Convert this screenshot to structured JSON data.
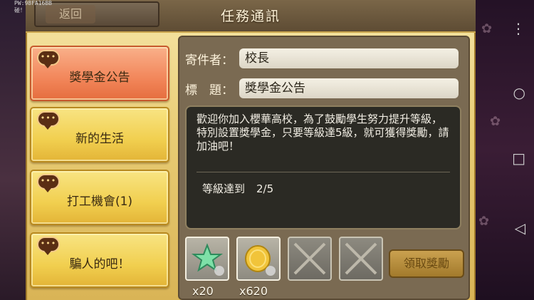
{
  "debug": {
    "line1": "PW:98FA16BB",
    "line2": "碰！"
  },
  "header": {
    "title": "任務通訊",
    "back_label": "返回"
  },
  "tabs": [
    {
      "label": "獎學金公告",
      "active": true
    },
    {
      "label": "新的生活",
      "active": false
    },
    {
      "label": "打工機會(1)",
      "active": false
    },
    {
      "label": "騙人的吧！",
      "active": false
    }
  ],
  "bubble_text": "•••",
  "mail": {
    "sender_label": "寄件者：",
    "sender": "校長",
    "subject_label": "標　題：",
    "subject": "獎學金公告",
    "body": "歡迎你加入櫻華高校，為了鼓勵學生努力提升等級，特別設置獎學金，只要等級達5級，就可獲得獎勵，請加油吧！",
    "requirement_label": "等級達到",
    "requirement_value": "2/5"
  },
  "rewards": [
    {
      "icon": "star-icon",
      "qty": "x20"
    },
    {
      "icon": "gold-coin-icon",
      "qty": "x620"
    },
    {
      "icon": "empty-slot-icon",
      "qty": ""
    },
    {
      "icon": "empty-slot-icon",
      "qty": ""
    }
  ],
  "claim_button": "領取獎勵",
  "system_icons": [
    "more-vert-icon",
    "home-icon",
    "square-icon",
    "back-icon"
  ],
  "colors": {
    "active_tab": "#f2865a",
    "tab": "#f1cf4f",
    "panel": "#7a6a52",
    "message_bg": "#2b2a24"
  }
}
